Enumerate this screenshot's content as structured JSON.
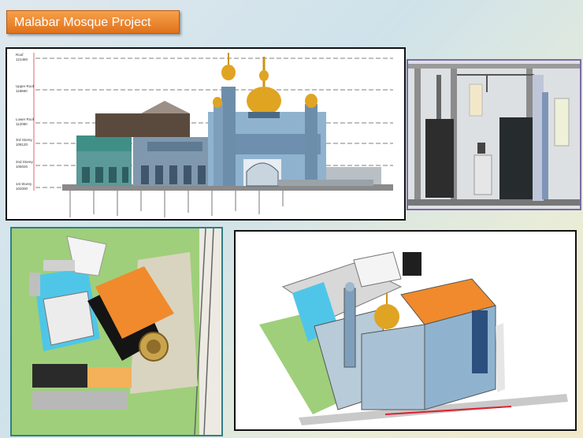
{
  "title": "Malabar Mosque Project",
  "elevation": {
    "levels": [
      {
        "name": "Roof",
        "value": "121460"
      },
      {
        "name": "Upper Roof",
        "value": "118660"
      },
      {
        "name": "Lower Roof",
        "value": "112080"
      },
      {
        "name": "3rd Storey",
        "value": "108120"
      },
      {
        "name": "2nd Storey",
        "value": "105020"
      },
      {
        "name": "1st Storey",
        "value": "102000"
      }
    ]
  },
  "colors": {
    "title_fill": "#e67d22",
    "dome_gold": "#e0a423",
    "roof_orange": "#f08a2c",
    "facade_blue": "#8fb3cf",
    "grass": "#9fcf7a",
    "pool": "#4fc6e8"
  }
}
